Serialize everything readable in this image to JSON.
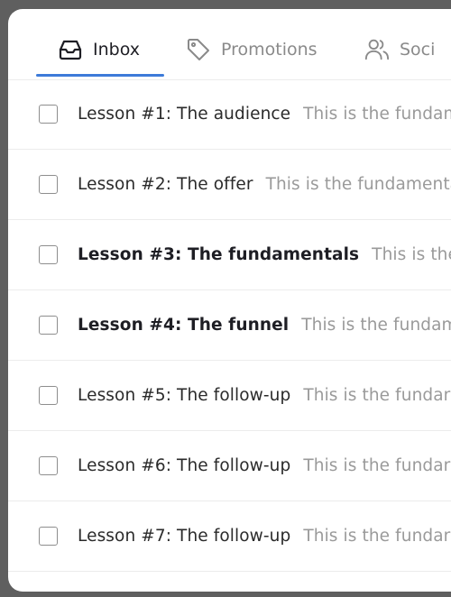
{
  "tabs": [
    {
      "label": "Inbox",
      "icon": "inbox-icon",
      "active": true
    },
    {
      "label": "Promotions",
      "icon": "tag-icon",
      "active": false
    },
    {
      "label": "Soci",
      "icon": "users-icon",
      "active": false
    }
  ],
  "colors": {
    "accent": "#3d7bd9",
    "frame": "#5f5f5f",
    "text": "#1e1e24",
    "muted": "#9a9a9a"
  },
  "messages": [
    {
      "subject": "Lesson #1: The audience",
      "snippet": "This is the fundam",
      "unread": false
    },
    {
      "subject": "Lesson #2: The offer",
      "snippet": "This is the fundamenta",
      "unread": false
    },
    {
      "subject": "Lesson #3: The fundamentals",
      "snippet": "This is the fu",
      "unread": true
    },
    {
      "subject": "Lesson #4: The funnel",
      "snippet": "This is the fundamen",
      "unread": true
    },
    {
      "subject": "Lesson #5: The follow-up",
      "snippet": "This is the fundar",
      "unread": false
    },
    {
      "subject": "Lesson #6: The follow-up",
      "snippet": "This is the fundar",
      "unread": false
    },
    {
      "subject": "Lesson #7: The follow-up",
      "snippet": "This is the fundar",
      "unread": false
    }
  ]
}
